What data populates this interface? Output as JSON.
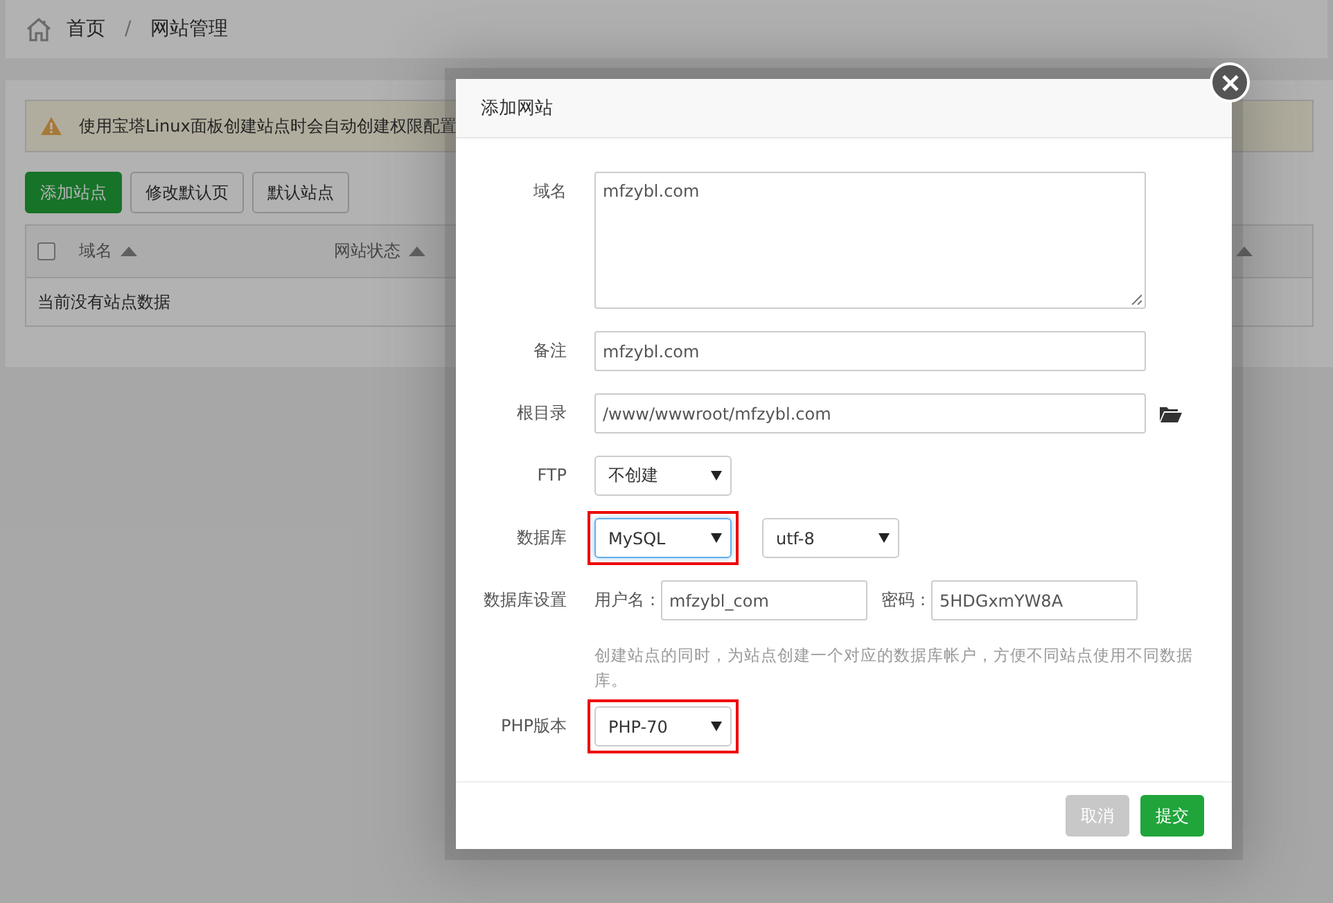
{
  "breadcrumb": {
    "separator": "/",
    "items": [
      "首页",
      "网站管理"
    ]
  },
  "alert": {
    "text": "使用宝塔Linux面板创建站点时会自动创建权限配置"
  },
  "toolbar": [
    {
      "label": "添加站点",
      "kind": "primary"
    },
    {
      "label": "修改默认页",
      "kind": "default"
    },
    {
      "label": "默认站点",
      "kind": "default"
    }
  ],
  "table": {
    "select_all_checked": false,
    "columns": [
      {
        "label": "域名",
        "sortable": true
      },
      {
        "label": "网站状态",
        "sortable": true
      },
      {
        "sortable": true
      }
    ],
    "empty_text": "当前没有站点数据"
  },
  "dialog": {
    "title": "添加网站",
    "fields": [
      {
        "kind": "textarea",
        "label": "域名",
        "value": "mfzybl.com"
      },
      {
        "kind": "input",
        "label": "备注",
        "value": "mfzybl.com"
      },
      {
        "kind": "path",
        "label": "根目录",
        "value": "/www/wwwroot/mfzybl.com"
      },
      {
        "kind": "selects",
        "label": "FTP",
        "selects": [
          {
            "value": "不创建",
            "focused": false,
            "highlighted": false
          }
        ]
      },
      {
        "kind": "selects",
        "label": "数据库",
        "selects": [
          {
            "value": "MySQL",
            "focused": true,
            "highlighted": true
          },
          {
            "value": "utf-8",
            "focused": false,
            "highlighted": false
          }
        ]
      },
      {
        "kind": "credentials",
        "label": "数据库设置",
        "user_label": "用户名：",
        "user": "mfzybl_com",
        "pass_label": "密码：",
        "pass": "5HDGxmYW8A",
        "hint": "创建站点的同时，为站点创建一个对应的数据库帐户，方便不同站点使用不同数据库。"
      },
      {
        "kind": "selects",
        "label": "PHP版本",
        "selects": [
          {
            "value": "PHP-70",
            "focused": false,
            "highlighted": true
          }
        ]
      }
    ],
    "buttons": [
      {
        "label": "取消",
        "kind": "cancel"
      },
      {
        "label": "提交",
        "kind": "submit"
      }
    ]
  }
}
